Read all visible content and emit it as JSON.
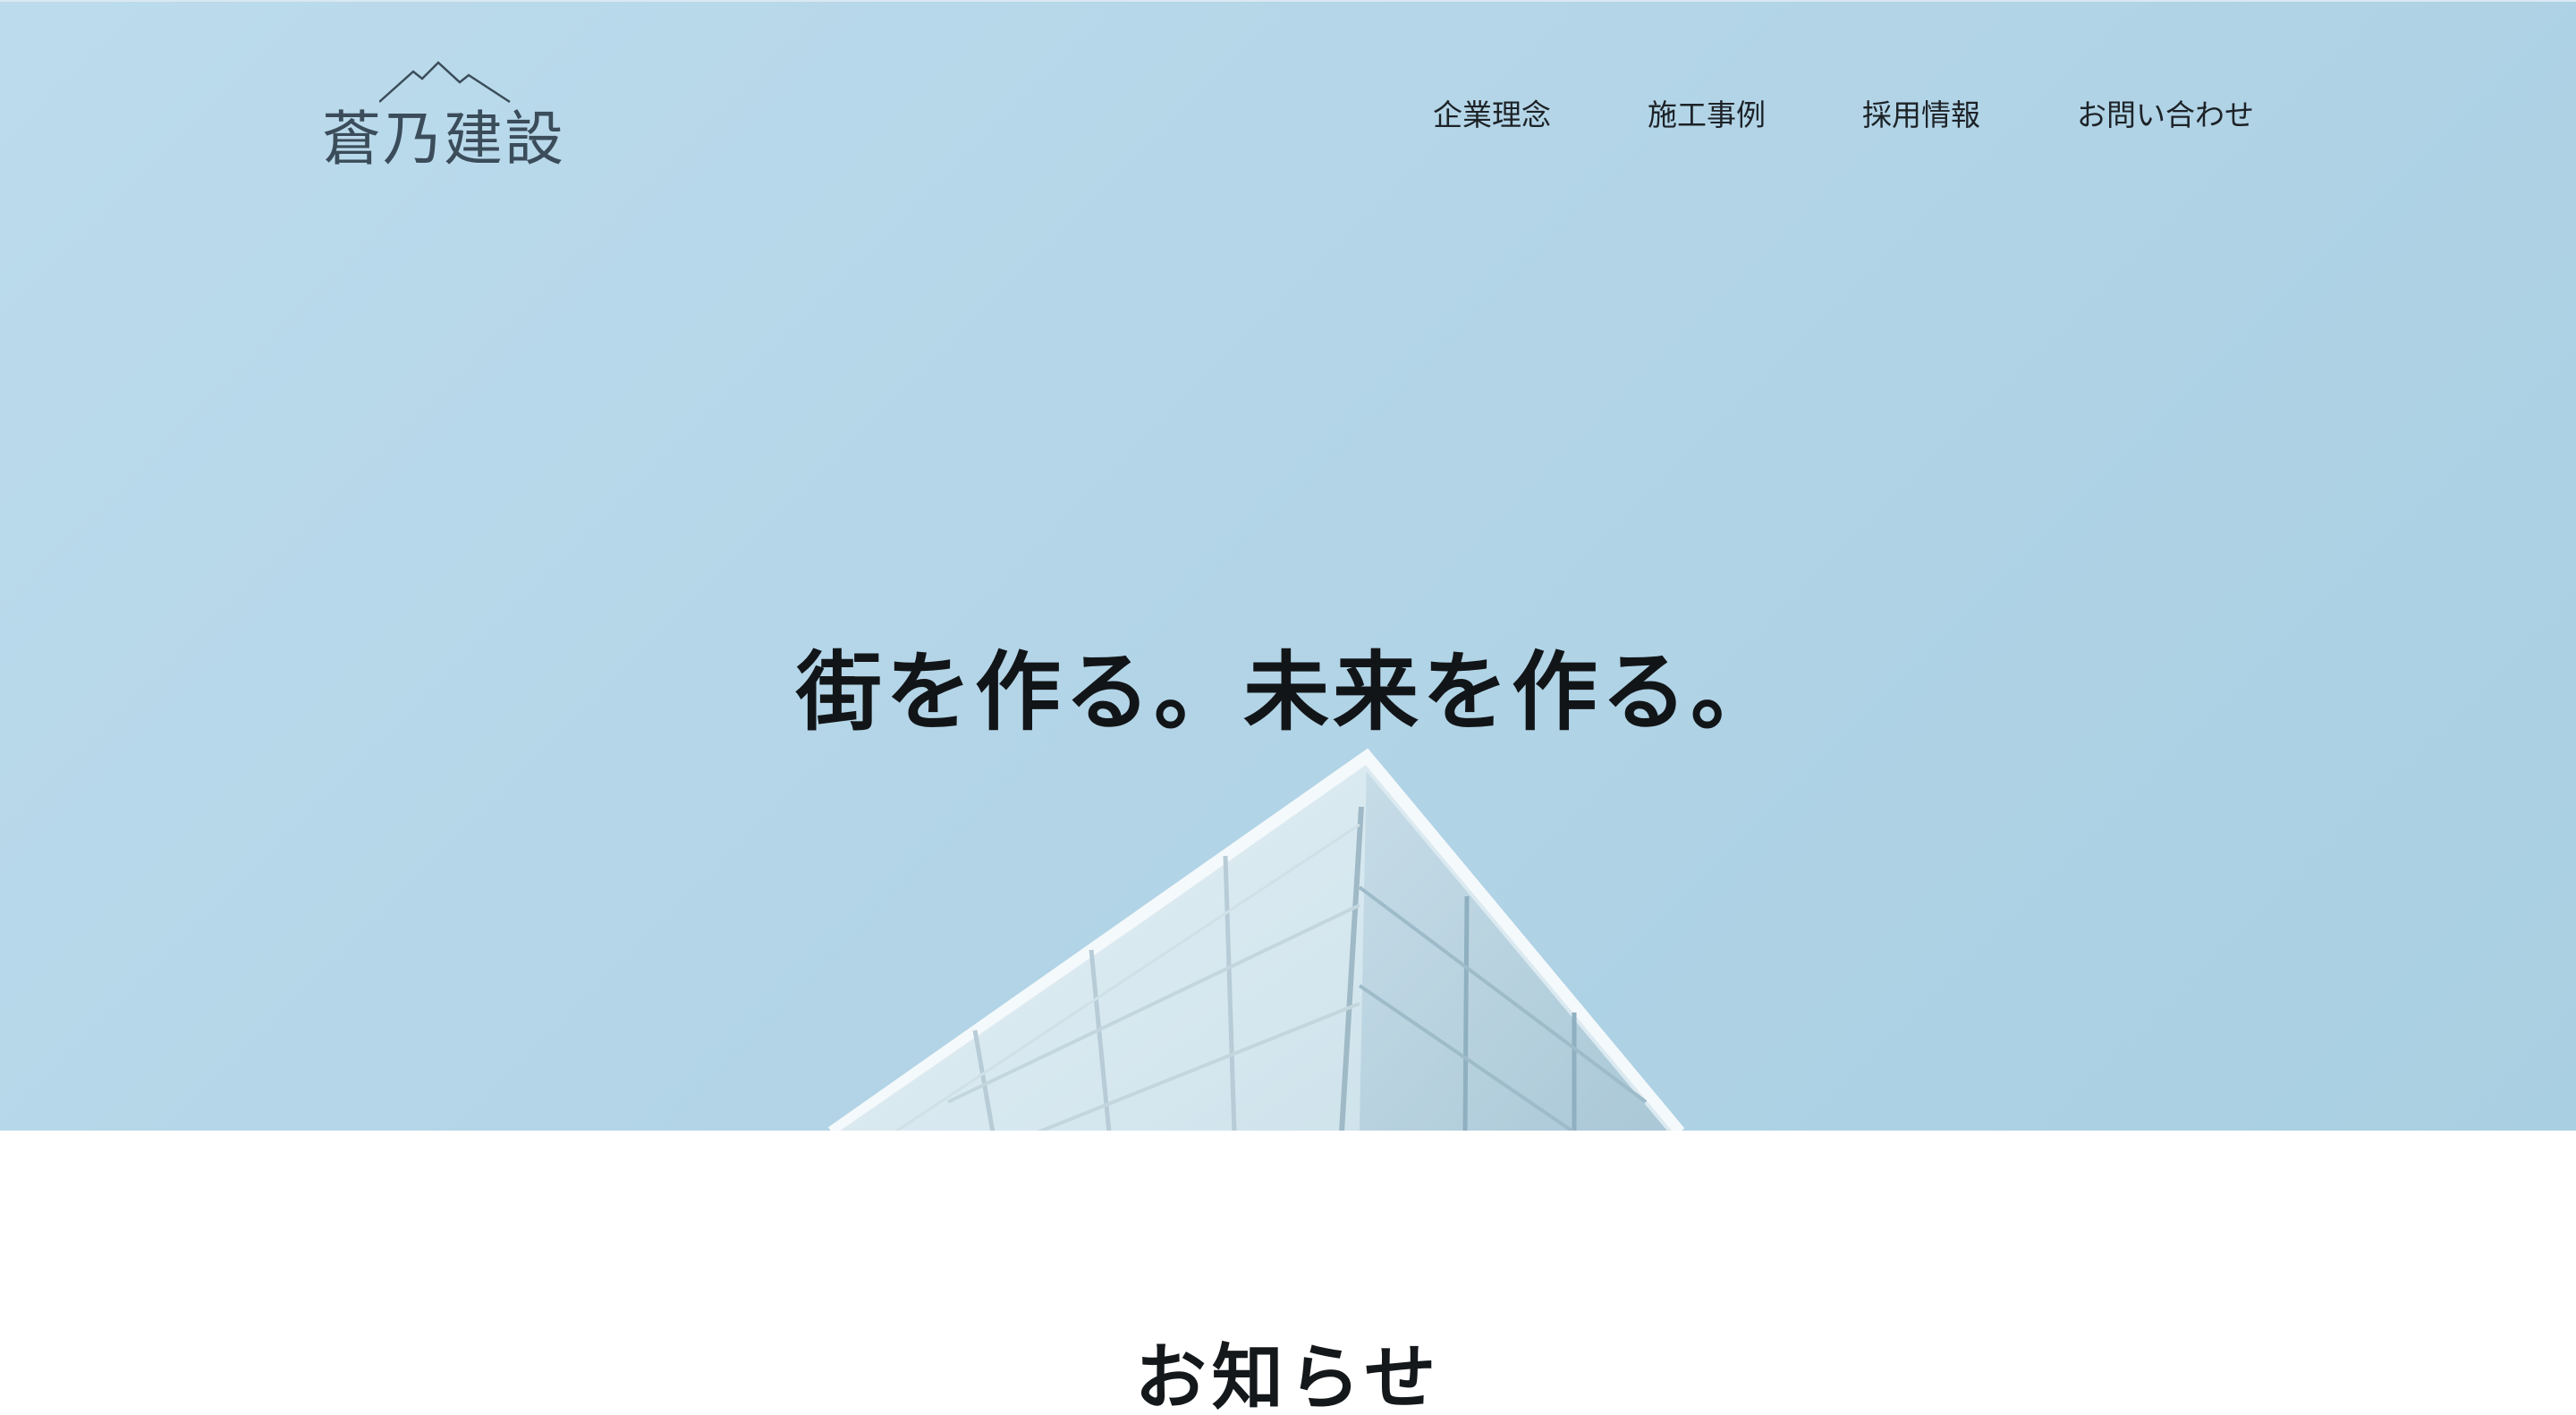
{
  "header": {
    "logo_text": "蒼乃建設",
    "nav": [
      {
        "label": "企業理念"
      },
      {
        "label": "施工事例"
      },
      {
        "label": "採用情報"
      },
      {
        "label": "お問い合わせ"
      }
    ]
  },
  "hero": {
    "tagline": "街を作る。未来を作る。"
  },
  "news": {
    "heading": "お知らせ"
  },
  "colors": {
    "sky": "#b6d7e8",
    "logo": "#3b4c5a",
    "text": "#15181b"
  },
  "icons": {
    "logo_mark": "mountain-icon"
  }
}
